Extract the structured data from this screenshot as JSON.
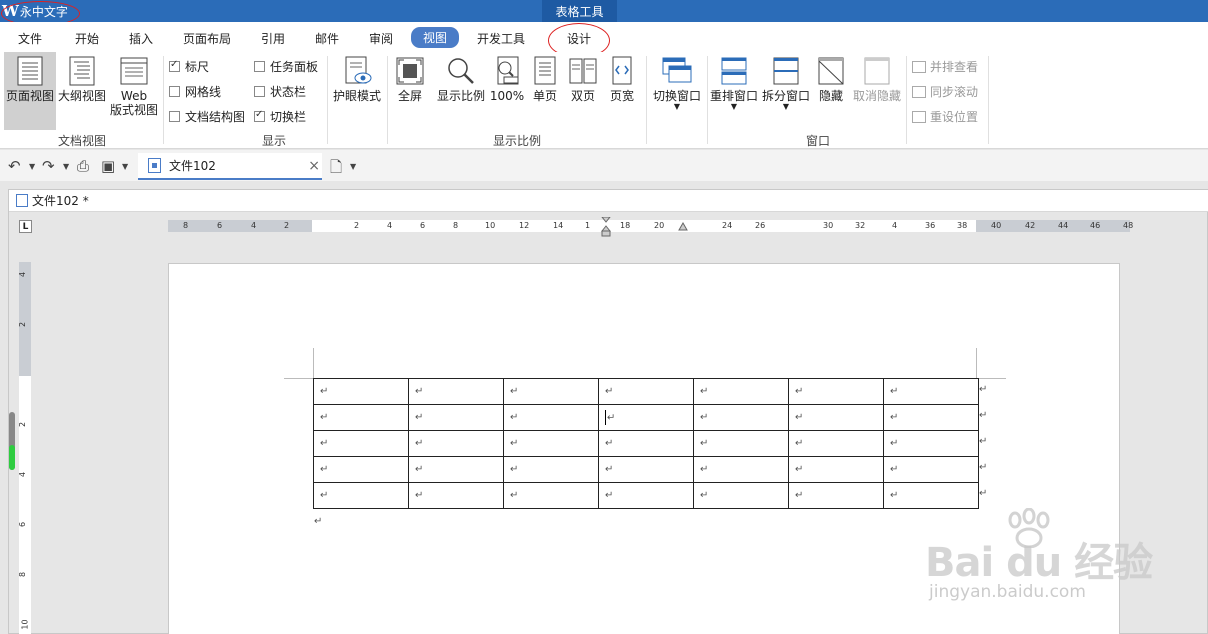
{
  "titlebar": {
    "app_logo": "W",
    "app_name": "永中文字",
    "context_tab": "表格工具"
  },
  "tabs": [
    {
      "label": "文件"
    },
    {
      "label": "开始"
    },
    {
      "label": "插入"
    },
    {
      "label": "页面布局"
    },
    {
      "label": "引用"
    },
    {
      "label": "邮件"
    },
    {
      "label": "审阅"
    },
    {
      "label": "视图",
      "active": true
    },
    {
      "label": "开发工具"
    },
    {
      "label": "设计"
    }
  ],
  "ribbon": {
    "doc_view": {
      "group_label": "文档视图",
      "page_view": "页面视图",
      "outline_view": "大纲视图",
      "web_view_line1": "Web",
      "web_view_line2": "版式视图"
    },
    "show": {
      "group_label": "显示",
      "ruler": "标尺",
      "ruler_checked": true,
      "gridlines": "网格线",
      "gridlines_checked": false,
      "doc_map": "文档结构图",
      "doc_map_checked": false,
      "task_pane": "任务面板",
      "task_pane_checked": false,
      "status_bar": "状态栏",
      "status_bar_checked": false,
      "switch_bar": "切换栏",
      "switch_bar_checked": true
    },
    "eye_mode": "护眼模式",
    "fullscreen": "全屏",
    "zoom": {
      "group_label": "显示比例",
      "zoom_ratio": "显示比例",
      "zoom_100": "100%",
      "single_page": "单页",
      "two_pages": "双页",
      "page_width": "页宽"
    },
    "window": {
      "group_label": "窗口",
      "switch_window": "切换窗口",
      "rearrange_window": "重排窗口",
      "split_window": "拆分窗口",
      "hide": "隐藏",
      "unhide": "取消隐藏",
      "side_by_side": "并排查看",
      "sync_scroll": "同步滚动",
      "reset_position": "重设位置"
    }
  },
  "doc_tab": {
    "name": "文件102",
    "close": "×"
  },
  "doc_window": {
    "title": "文件102 *",
    "ruler_corner": "L"
  },
  "hruler_ticks": [
    "8",
    "6",
    "4",
    "2",
    "2",
    "4",
    "6",
    "8",
    "10",
    "12",
    "14",
    "1",
    "18",
    "20",
    "24",
    "26",
    "30",
    "32",
    "4",
    "36",
    "38",
    "40",
    "42",
    "44",
    "46",
    "48"
  ],
  "vruler_ticks": [
    "4",
    "2",
    "2",
    "4",
    "6",
    "8",
    "10"
  ],
  "table": {
    "rows": 5,
    "cols": 7,
    "cell_mark": "↵",
    "cursor_row": 1,
    "cursor_col": 3
  },
  "after_table_mark": "↵",
  "watermark": {
    "main": "Bai du 经验",
    "sub": "jingyan.baidu.com"
  },
  "colors": {
    "titlebar": "#2b6cb8",
    "context_tab": "#1e5aa3",
    "active_tab": "#4a7cc7",
    "annotation_red": "#dd2222"
  }
}
